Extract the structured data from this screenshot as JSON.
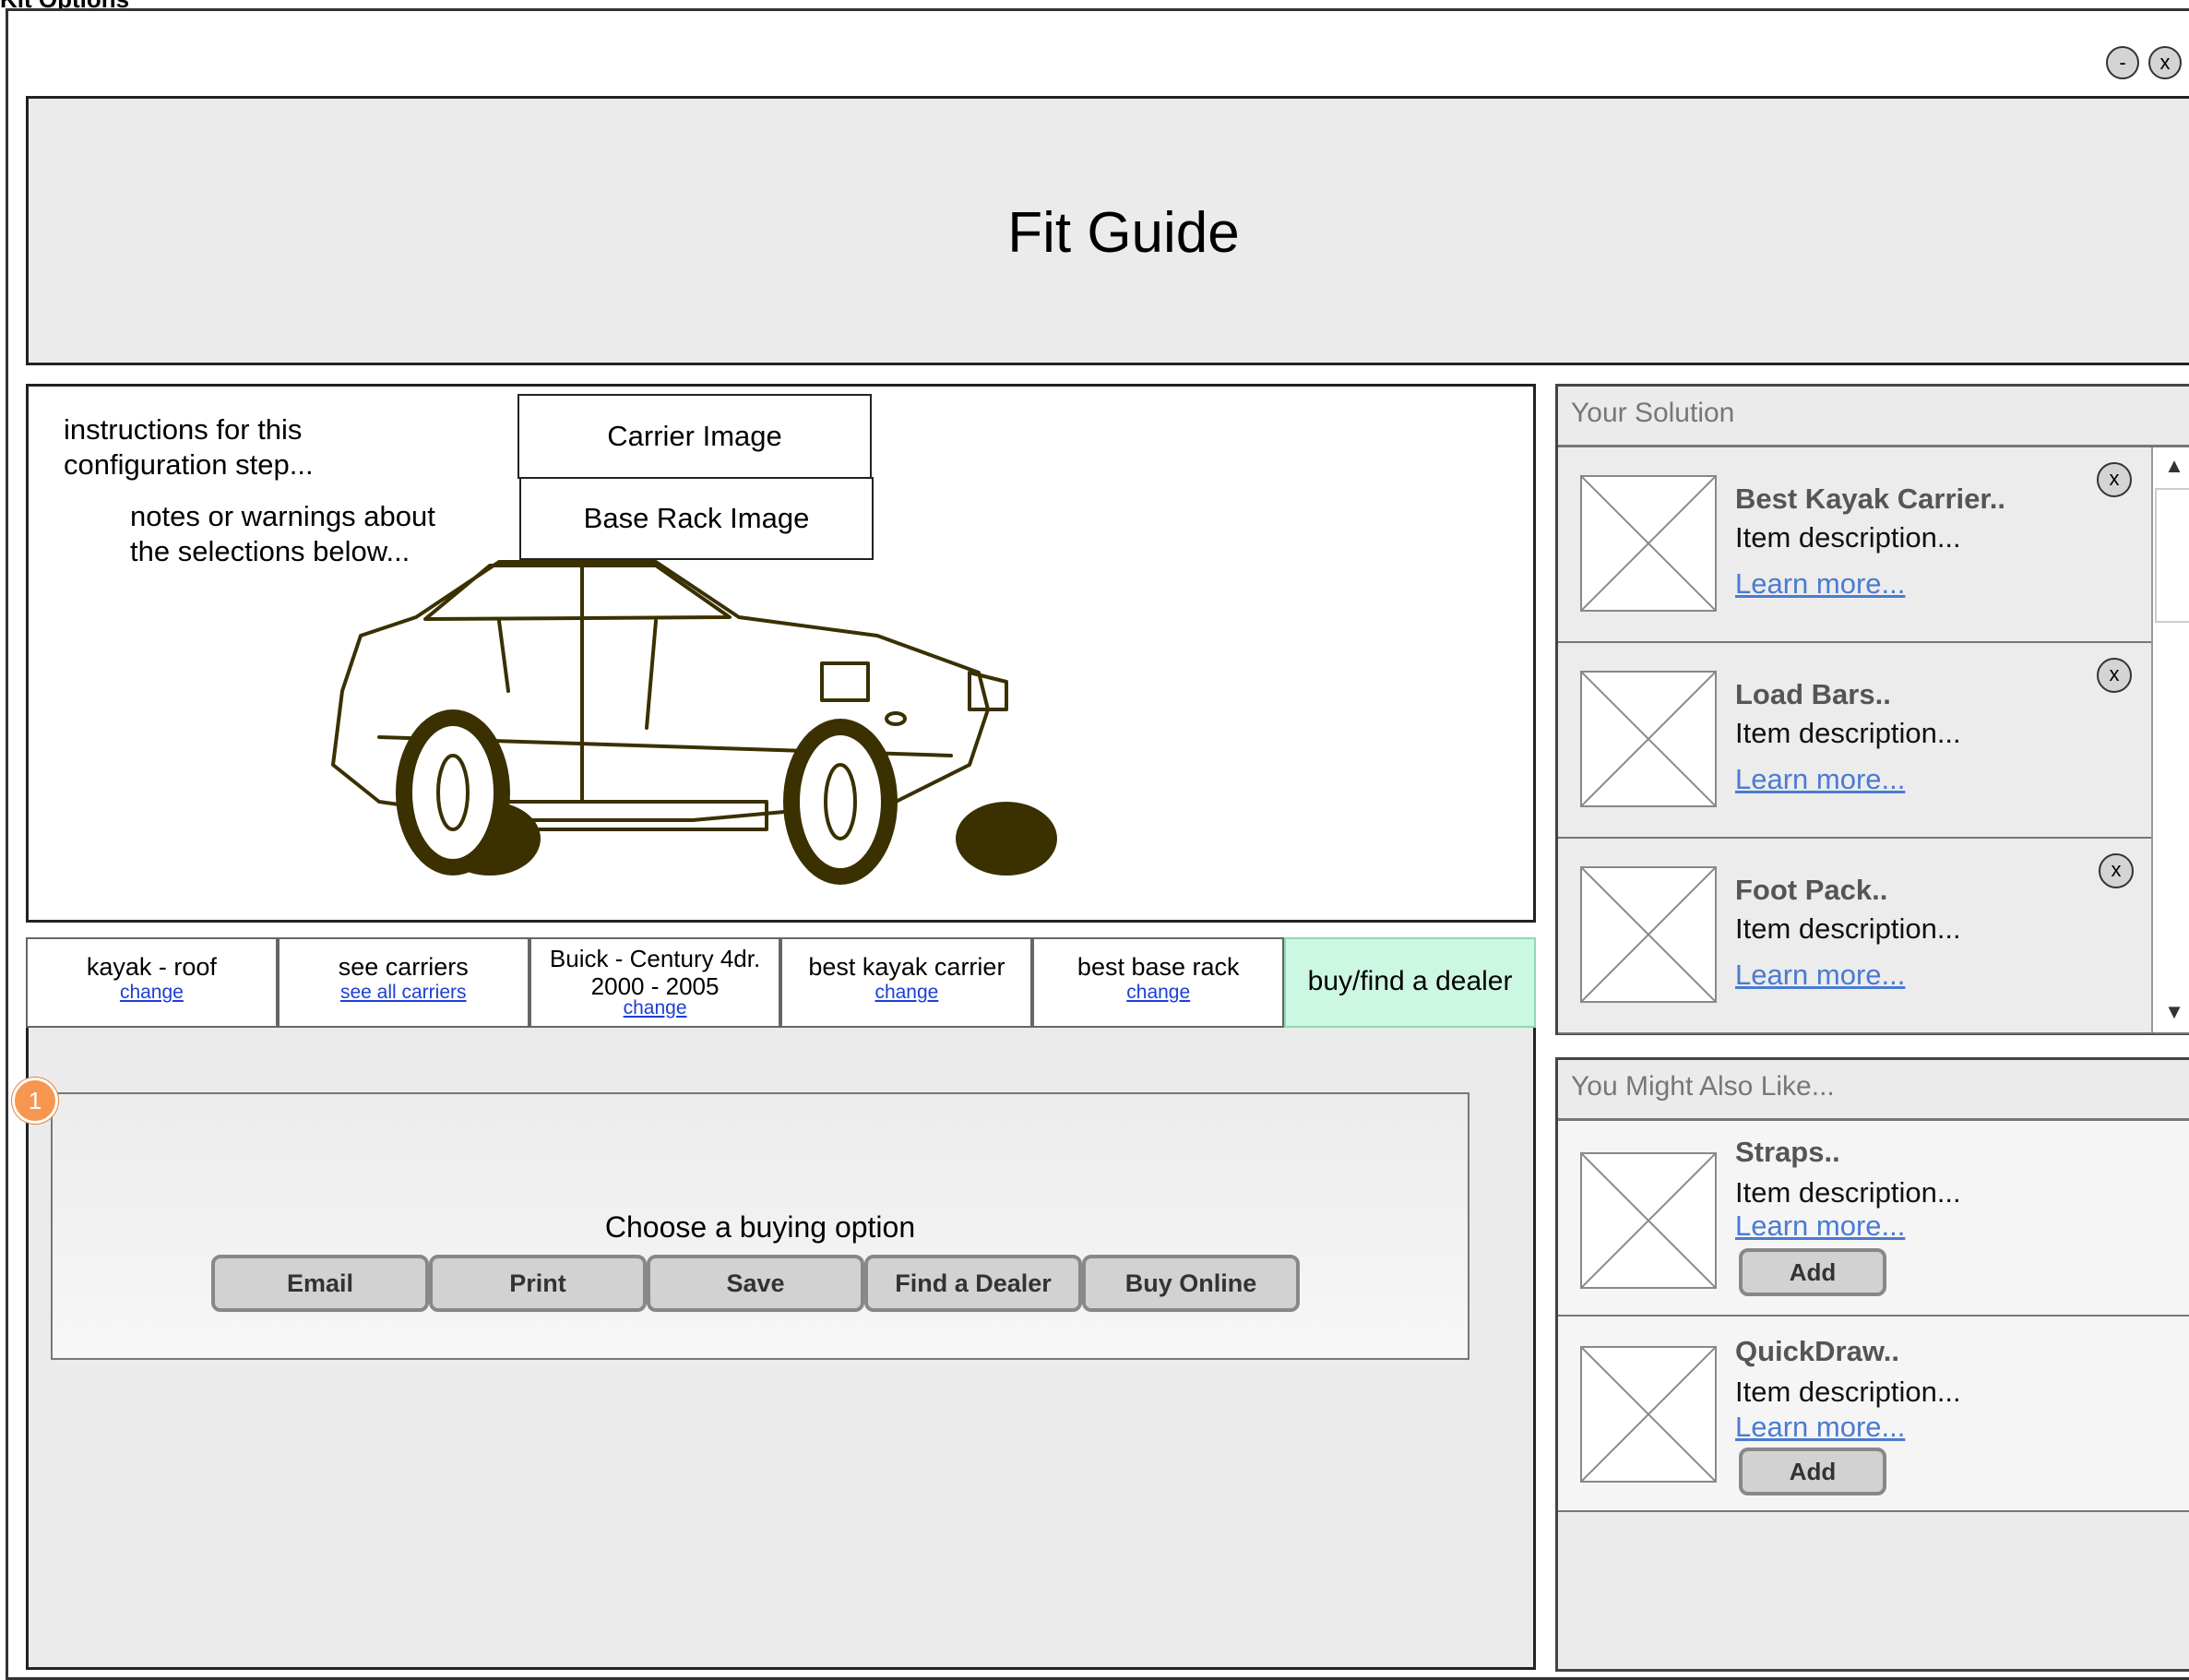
{
  "page_label": "Kit Options",
  "window": {
    "minimize_label": "-",
    "close_label": "x"
  },
  "header": {
    "title": "Fit Guide"
  },
  "stage": {
    "instructions": "instructions for this configuration step...",
    "notes": "notes or warnings about the selections below...",
    "carrier_image": "Carrier Image",
    "base_rack_image": "Base Rack Image"
  },
  "steps": [
    {
      "title": "kayak - roof",
      "link": "change"
    },
    {
      "title": "see carriers",
      "link": "see all carriers"
    },
    {
      "title": "Buick - Century 4dr. 2000 - 2005",
      "link": "change"
    },
    {
      "title": "best kayak carrier",
      "link": "change"
    },
    {
      "title": "best base rack",
      "link": "change"
    },
    {
      "title": "buy/find a dealer"
    }
  ],
  "buying": {
    "marker": "1",
    "label": "Choose a buying option",
    "buttons": [
      "Email",
      "Print",
      "Save",
      "Find a Dealer",
      "Buy Online"
    ]
  },
  "solution": {
    "title": "Your Solution",
    "items": [
      {
        "name": "Best Kayak Carrier..",
        "desc": "Item description...",
        "link": "Learn more...",
        "close": "x"
      },
      {
        "name": "Load Bars..",
        "desc": "Item description...",
        "link": "Learn more...",
        "close": "x"
      },
      {
        "name": "Foot Pack..",
        "desc": "Item description...",
        "link": "Learn more...",
        "close": "x"
      }
    ]
  },
  "also_like": {
    "title": "You Might Also Like...",
    "items": [
      {
        "name": "Straps..",
        "desc": "Item description...",
        "link": "Learn more...",
        "add": "Add"
      },
      {
        "name": "QuickDraw..",
        "desc": "Item description...",
        "link": "Learn more...",
        "add": "Add"
      }
    ]
  },
  "icons": {
    "scroll_up": "up-arrow-icon",
    "scroll_down": "down-arrow-icon",
    "thumbnail": "image-placeholder-icon"
  },
  "colors": {
    "active_step": "#ccf7e2",
    "link": "#4a7bd2",
    "marker": "#f79650"
  }
}
